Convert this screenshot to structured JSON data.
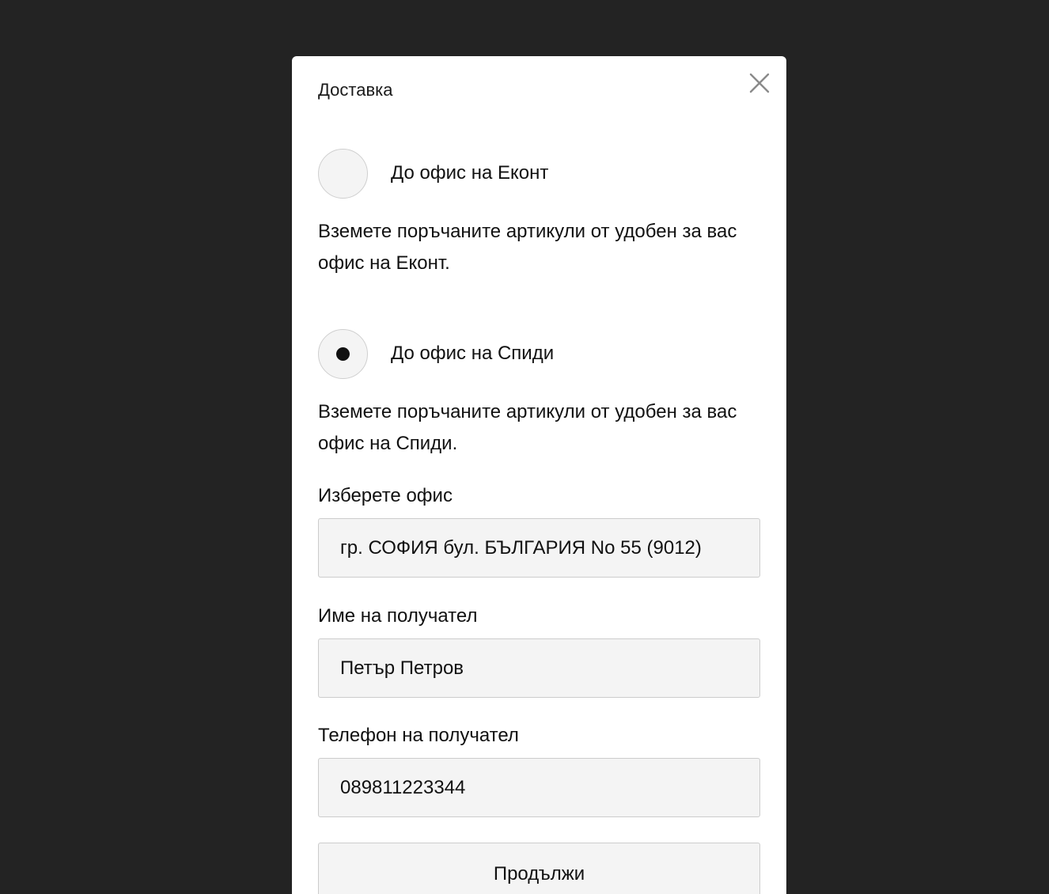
{
  "modal": {
    "title": "Доставка",
    "close_icon": "close-icon"
  },
  "options": [
    {
      "label": "До офис на Еконт",
      "description": "Вземете поръчаните артикули от удобен за вас офис на Еконт.",
      "selected": false
    },
    {
      "label": "До офис на Спиди",
      "description": "Вземете поръчаните артикули от удобен за вас офис на Спиди.",
      "selected": true
    }
  ],
  "form": {
    "office": {
      "label": "Изберете офис",
      "value": "гр. СОФИЯ бул. БЪЛГАРИЯ No 55 (9012)"
    },
    "recipient_name": {
      "label": "Име на получател",
      "value": "Петър Петров"
    },
    "recipient_phone": {
      "label": "Телефон на получател",
      "value": "089811223344"
    },
    "submit_label": "Продължи"
  },
  "colors": {
    "backdrop": "#232323",
    "modal_bg": "#ffffff",
    "field_bg": "#f4f4f4",
    "text": "#111111"
  }
}
